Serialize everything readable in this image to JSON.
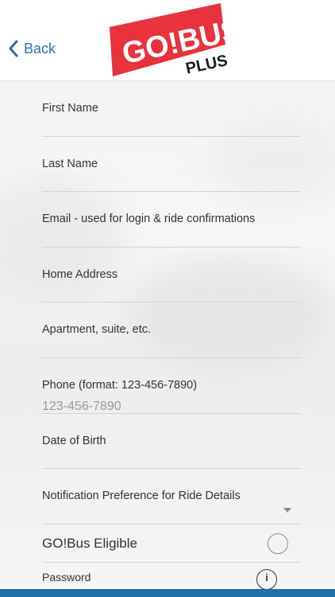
{
  "header": {
    "back_label": "Back",
    "logo_text_main": "GO!BUS",
    "logo_text_sub": "PLUS",
    "brand_color": "#e8323c",
    "accent_color": "#2f6fad"
  },
  "form": {
    "fields": [
      {
        "label": "First Name",
        "value": "",
        "placeholder": ""
      },
      {
        "label": "Last Name",
        "value": "",
        "placeholder": ""
      },
      {
        "label": "Email - used for login & ride confirmations",
        "value": "",
        "placeholder": ""
      },
      {
        "label": "Home Address",
        "value": "",
        "placeholder": ""
      },
      {
        "label": "Apartment, suite, etc.",
        "value": "",
        "placeholder": ""
      },
      {
        "label": "Phone (format: 123-456-7890)",
        "value": "",
        "placeholder": "123-456-7890"
      },
      {
        "label": "Date of Birth",
        "value": "",
        "placeholder": ""
      }
    ],
    "notification": {
      "label": "Notification Preference for Ride Details",
      "selected": ""
    },
    "eligible": {
      "label": "GO!Bus Eligible",
      "checked": false
    },
    "password": {
      "label": "Password",
      "info_icon": "i"
    }
  }
}
